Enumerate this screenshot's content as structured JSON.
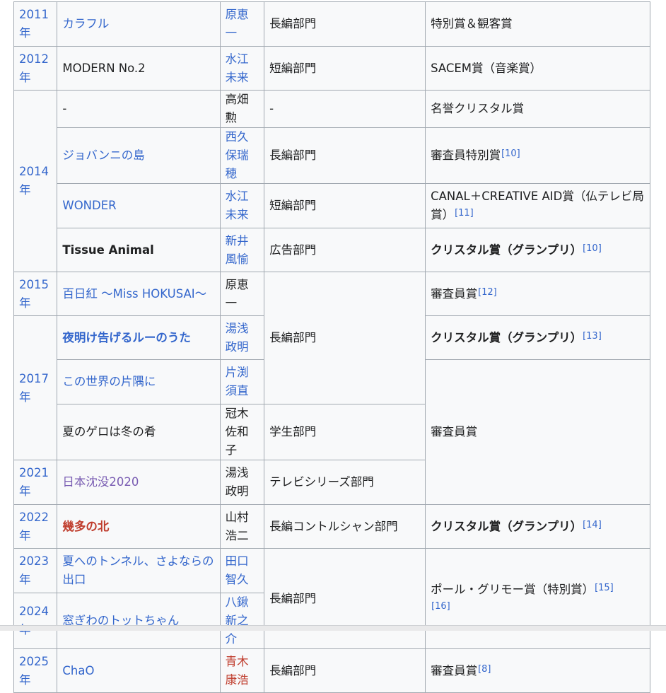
{
  "rows": [
    {
      "year": "2011年",
      "title": "カラフル",
      "person": "原恵一",
      "category": "長編部門",
      "award": "特別賞＆観客賞"
    },
    {
      "year": "2012年",
      "title": "MODERN No.2",
      "person": "水江未来",
      "category": "短編部門",
      "award": "SACEM賞（音楽賞）"
    },
    {
      "year": "2014年",
      "title": "-",
      "person": "高畑勲",
      "category": "-",
      "award": "名誉クリスタル賞"
    },
    {
      "title": "ジョバンニの島",
      "person": "西久保瑞穂",
      "category": "長編部門",
      "award": "審査員特別賞",
      "ref": "[10]"
    },
    {
      "title": "WONDER",
      "person": "水江未来",
      "category": "短編部門",
      "award": "CANAL＋CREATIVE AID賞（仏テレビ局賞）",
      "ref": "[11]"
    },
    {
      "title": "Tissue Animal",
      "person": "新井風愉",
      "category": "広告部門",
      "award": "クリスタル賞（グランプリ）",
      "ref": "[10]"
    },
    {
      "year": "2015年",
      "title": "百日紅 〜Miss HOKUSAI〜",
      "person": "原恵一",
      "category": "長編部門",
      "award": "審査員賞",
      "ref": "[12]"
    },
    {
      "year": "2017年",
      "title": "夜明け告げるルーのうた",
      "person": "湯浅政明",
      "award": "クリスタル賞（グランプリ）",
      "ref": "[13]"
    },
    {
      "title": "この世界の片隅に",
      "person": "片渕須直",
      "award": "審査員賞"
    },
    {
      "title": "夏のゲロは冬の肴",
      "person": "冠木佐和子",
      "category": "学生部門"
    },
    {
      "year": "2021年",
      "title": "日本沈没2020",
      "person": "湯浅政明",
      "category": "テレビシリーズ部門"
    },
    {
      "year": "2022年",
      "title": "幾多の北",
      "person": "山村浩二",
      "category": "長編コントルシャン部門",
      "award": "クリスタル賞（グランプリ）",
      "ref": "[14]"
    },
    {
      "year": "2023年",
      "title": "夏へのトンネル、さよならの出口",
      "person": "田口智久",
      "category": "長編部門",
      "award": "ポール・グリモー賞（特別賞）",
      "ref": "[15]",
      "ref2": "[16]"
    },
    {
      "year": "2024年",
      "title": "窓ぎわのトットちゃん",
      "person": "八鍬新之介"
    },
    {
      "year": "2025年",
      "title": "ChaO",
      "person": "青木康浩",
      "category": "長編部門",
      "award": "審査員賞",
      "ref": "[8]"
    }
  ],
  "colors": {
    "link": "#3366cc",
    "visited": "#795cb2",
    "redlink": "#bf3c2c",
    "border": "#a2a9b1",
    "cell_bg": "#f8f9fa"
  }
}
